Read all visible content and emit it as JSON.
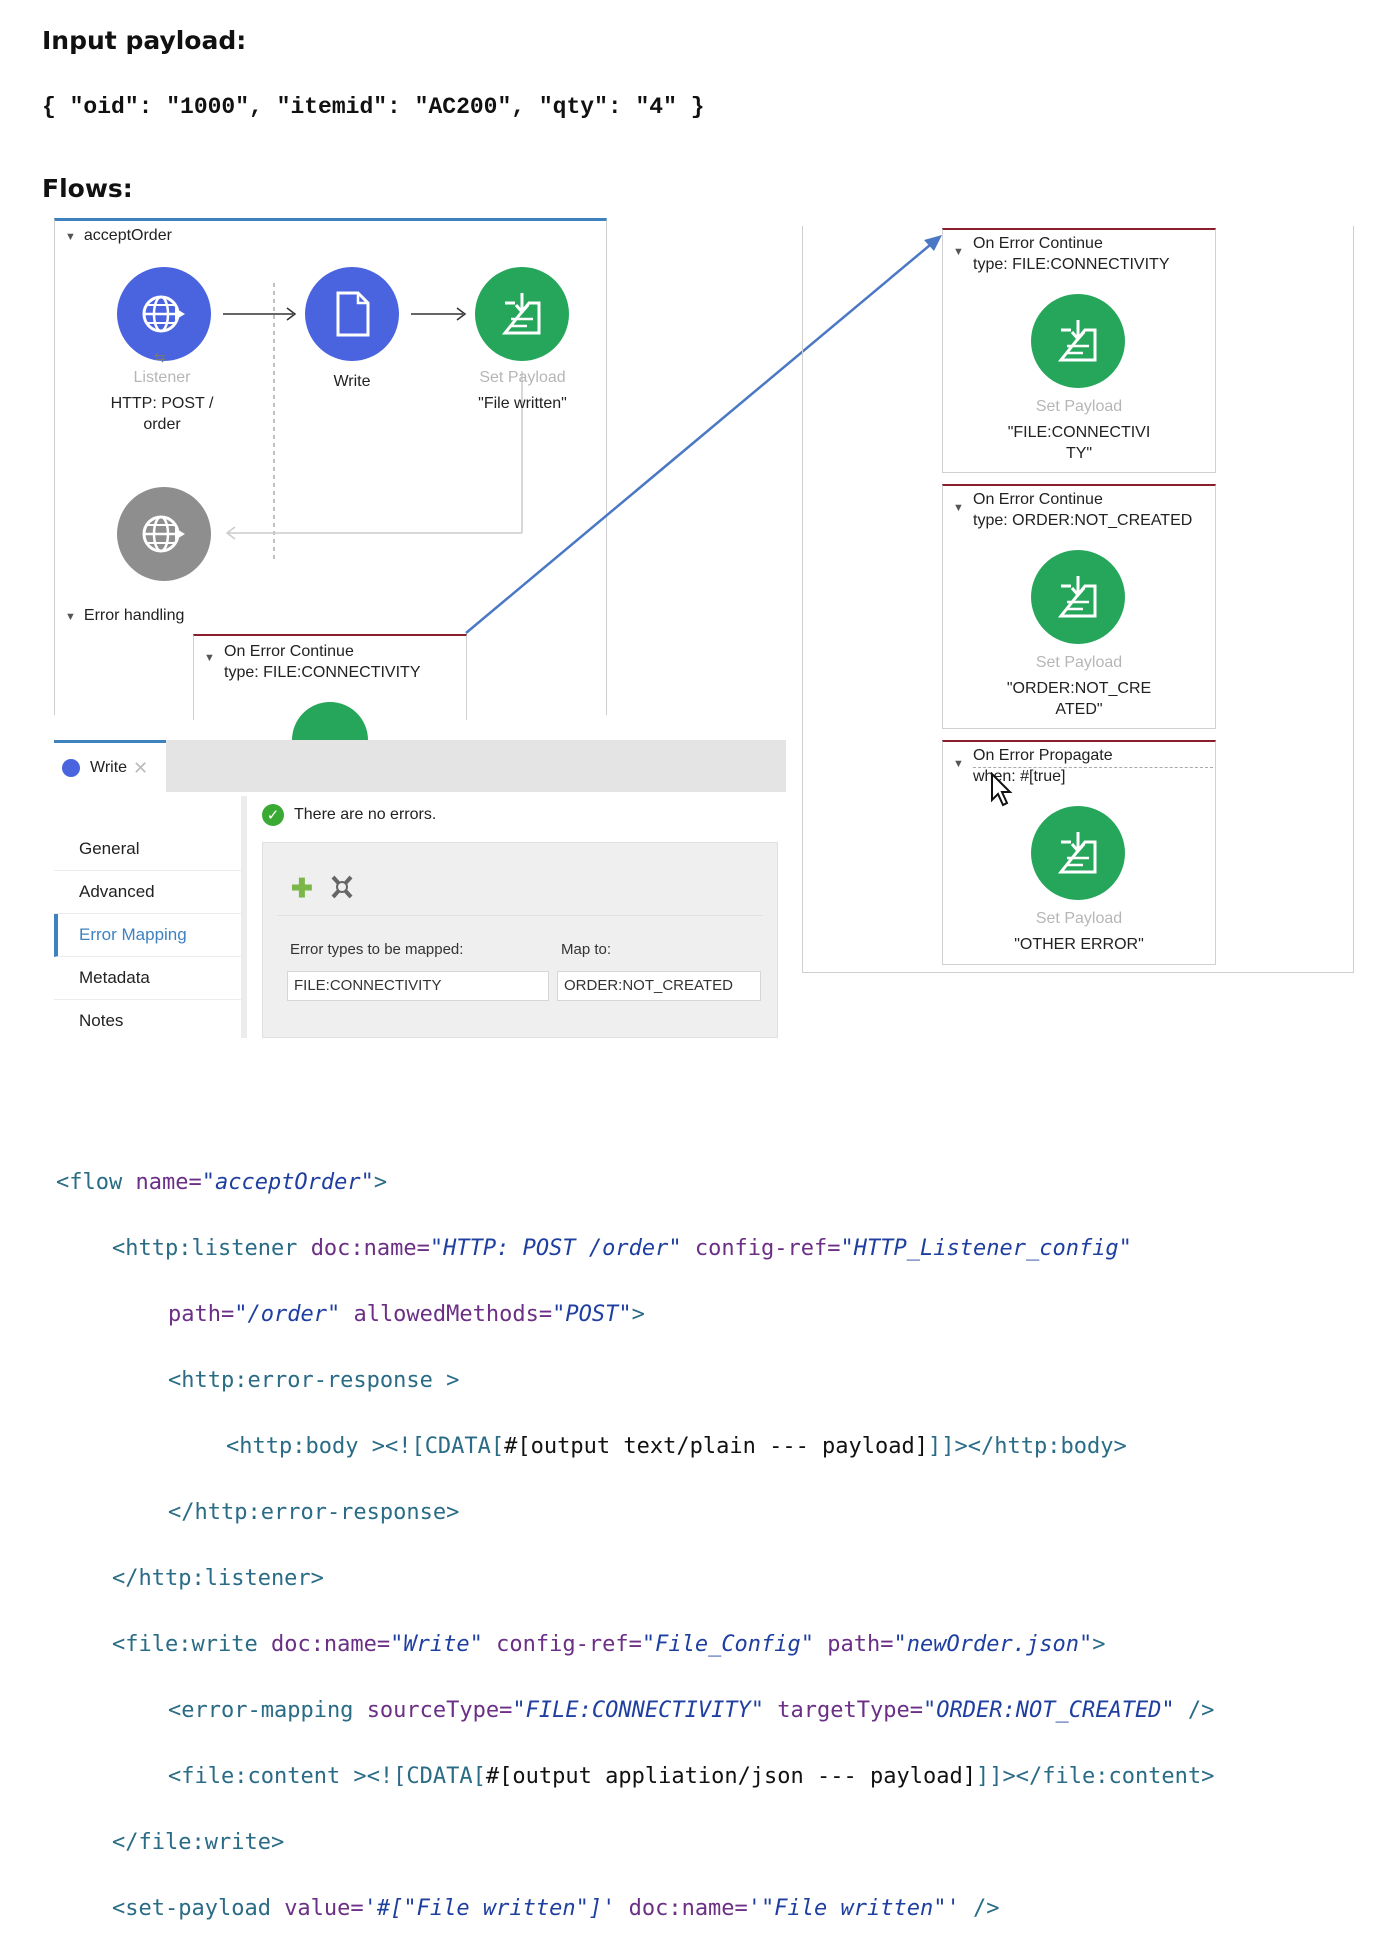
{
  "headings": {
    "input_payload": "Input payload:",
    "flows": "Flows:"
  },
  "payload": "{ \"oid\": \"1000\", \"itemid\": \"AC200\", \"qty\": \"4\" }",
  "flow": {
    "title": "acceptOrder",
    "listener": {
      "type": "Listener",
      "name": "HTTP: POST /",
      "name2": "order"
    },
    "write": {
      "name": "Write"
    },
    "set_payload": {
      "type": "Set Payload",
      "value": "\"File written\""
    },
    "error_handling": "Error handling",
    "inline_handler": {
      "line1": "On Error Continue",
      "line2": "type: FILE:CONNECTIVITY"
    }
  },
  "handlers": [
    {
      "line1": "On Error Continue",
      "line2": "type: FILE:CONNECTIVITY",
      "proc_type": "Set Payload",
      "val1": "\"FILE:CONNECTIVI",
      "val2": "TY\""
    },
    {
      "line1": "On Error Continue",
      "line2": "type: ORDER:NOT_CREATED",
      "proc_type": "Set Payload",
      "val1": "\"ORDER:NOT_CRE",
      "val2": "ATED\""
    },
    {
      "line1": "On Error Propagate",
      "line2": "when: #[true]",
      "proc_type": "Set Payload",
      "val1": "\"OTHER ERROR\"",
      "val2": ""
    }
  ],
  "editor": {
    "tab": "Write",
    "status": "There are no errors.",
    "sidebar": [
      "General",
      "Advanced",
      "Error Mapping",
      "Metadata",
      "Notes"
    ],
    "active_index": 2,
    "col1_label": "Error types to be mapped:",
    "col2_label": "Map to:",
    "col1_value": "FILE:CONNECTIVITY",
    "col2_value": "ORDER:NOT_CREATED"
  },
  "code": {
    "l1": {
      "tag": "<flow ",
      "a1": "name=",
      "v1": "\"acceptOrder\"",
      "end": ">"
    },
    "l2": {
      "tag": "<http:listener ",
      "a1": "doc:name=",
      "v1": "\"HTTP: POST /order\"",
      "a2": " config-ref=",
      "v2": "\"HTTP_Listener_config\""
    },
    "l3": {
      "a1": "path=",
      "v1": "\"/order\"",
      "a2": " allowedMethods=",
      "v2": "\"POST\"",
      "end": ">"
    },
    "l4": {
      "tag": "<http:error-response >"
    },
    "l5": {
      "tag": "<http:body >",
      "cdata_open": "<![CDATA[",
      "body": "#[output text/plain --- payload]",
      "cdata_close": "]]>",
      "close": "</http:body>"
    },
    "l6": {
      "tag": "</http:error-response>"
    },
    "l7": {
      "tag": "</http:listener>"
    },
    "l8": {
      "tag": "<file:write ",
      "a1": "doc:name=",
      "v1": "\"Write\"",
      "a2": " config-ref=",
      "v2": "\"File_Config\"",
      "a3": " path=",
      "v3": "\"newOrder.json\"",
      "end": ">"
    },
    "l9": {
      "tag": "<error-mapping ",
      "a1": "sourceType=",
      "v1": "\"FILE:CONNECTIVITY\"",
      "a2": " targetType=",
      "v2": "\"ORDER:NOT_CREATED\"",
      "end": " />"
    },
    "l10": {
      "tag": "<file:content >",
      "cdata_open": "<![CDATA[",
      "body": "#[output appliation/json --- payload]",
      "cdata_close": "]]>",
      "close": "</file:content>"
    },
    "l11": {
      "tag": "</file:write>"
    },
    "l12": {
      "tag": "<set-payload ",
      "a1": "value=",
      "v1": "'#[\"File written\"]'",
      "a2": " doc:name=",
      "v2": "'\"File written\"'",
      "end": " />"
    }
  }
}
